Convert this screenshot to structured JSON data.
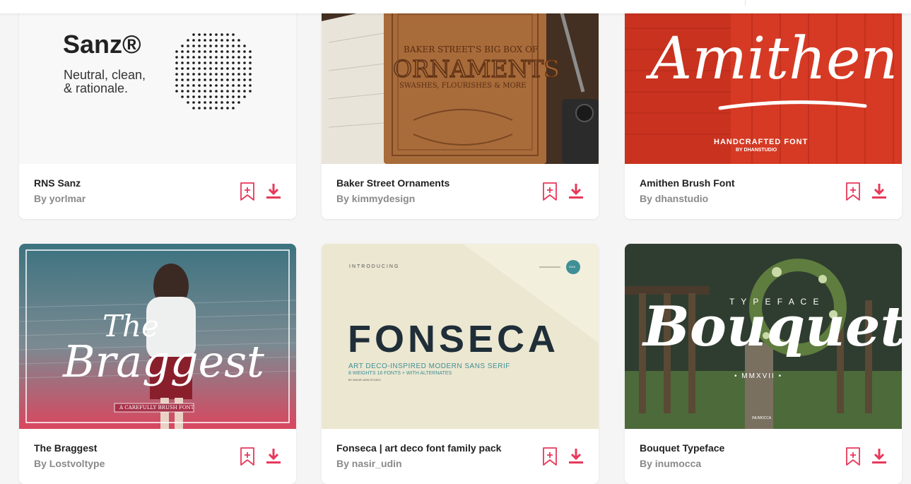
{
  "accent_color": "#e8385b",
  "cards": [
    {
      "name": "RNS Sanz",
      "author": "By yorlmar",
      "preview": {
        "logo": "Sanz®",
        "tagline_1": "Neutral, clean,",
        "tagline_2": "& rationale."
      }
    },
    {
      "name": "Baker Street Ornaments",
      "author": "By kimmydesign",
      "preview": {
        "line_1": "BAKER STREET'S BIG BOX OF",
        "word": "ORNAMENTS",
        "line_2": "SWASHES, FLOURISHES & MORE"
      }
    },
    {
      "name": "Amithen Brush Font",
      "author": "By dhanstudio",
      "preview": {
        "word": "Amithen",
        "sub": "HANDCRAFTED FONT",
        "credit": "BY DHANSTUDIO"
      }
    },
    {
      "name": "The Braggest",
      "author": "By Lostvoltype",
      "preview": {
        "word_1": "The",
        "word_2": "Braggest",
        "ribbon": "A CAREFULLY BRUSH FONT"
      }
    },
    {
      "name": "Fonseca | art deco font family pack",
      "author": "By nasir_udin",
      "preview": {
        "intro": "INTRODUCING",
        "badge": "2016",
        "word": "FONSECA",
        "sub": "ART DECO-INSPIRED MODERN SANS SERIF",
        "details": "8 WEIGHTS 16 FONTS + WITH ALTERNATES",
        "credit": "BY NASIR UDIN STUDIO"
      }
    },
    {
      "name": "Bouquet Typeface",
      "author": "By inumocca",
      "preview": {
        "top": "T Y P E F A C E",
        "word": "Bouquet",
        "year": "• MMXVII •",
        "credit": "INUMOCCA"
      }
    }
  ]
}
